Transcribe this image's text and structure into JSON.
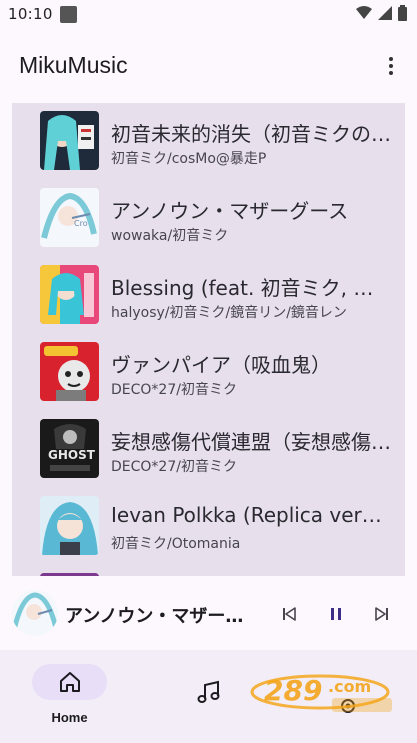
{
  "status": {
    "time": "10:10"
  },
  "app": {
    "title": "MikuMusic"
  },
  "songs": [
    {
      "title": " 初音未来的消失（初音ミクの消失）",
      "artist": "初音ミク/cosMo@暴走P",
      "cover_bg": "#1f2a3a",
      "cover_accent": "#5fd0d6"
    },
    {
      "title": " アンノウン・マザーグース",
      "artist": "wowaka/初音ミク",
      "cover_bg": "#f4f7fb",
      "cover_accent": "#7cc9d8"
    },
    {
      "title": "Blessing (feat. 初音ミク, 鏡音リン)",
      "artist": "halyosy/初音ミク/鏡音リン/鏡音レン",
      "cover_bg": "#e8477a",
      "cover_accent": "#3ac4d8"
    },
    {
      "title": "ヴァンパイア（吸血鬼）",
      "artist": "DECO*27/初音ミク",
      "cover_bg": "#d8232e",
      "cover_accent": "#f2f2f2"
    },
    {
      "title": " 妄想感傷代償連盟（妄想感傷代償連盟）",
      "artist": "DECO*27/初音ミク",
      "cover_bg": "#1a1a1a",
      "cover_accent": "#e8e8e8"
    },
    {
      "title": "Ievan Polkka (Replica version)",
      "artist": "初音ミク/Otomania",
      "cover_bg": "#dfeef6",
      "cover_accent": "#59b9d4"
    }
  ],
  "player": {
    "title": "アンノウン・マザーグース"
  },
  "nav": {
    "home_label": "Home"
  },
  "colors": {
    "panel": "#e7e0ec",
    "nav_active": "#e8def8",
    "watermark": "#f4a61c"
  }
}
